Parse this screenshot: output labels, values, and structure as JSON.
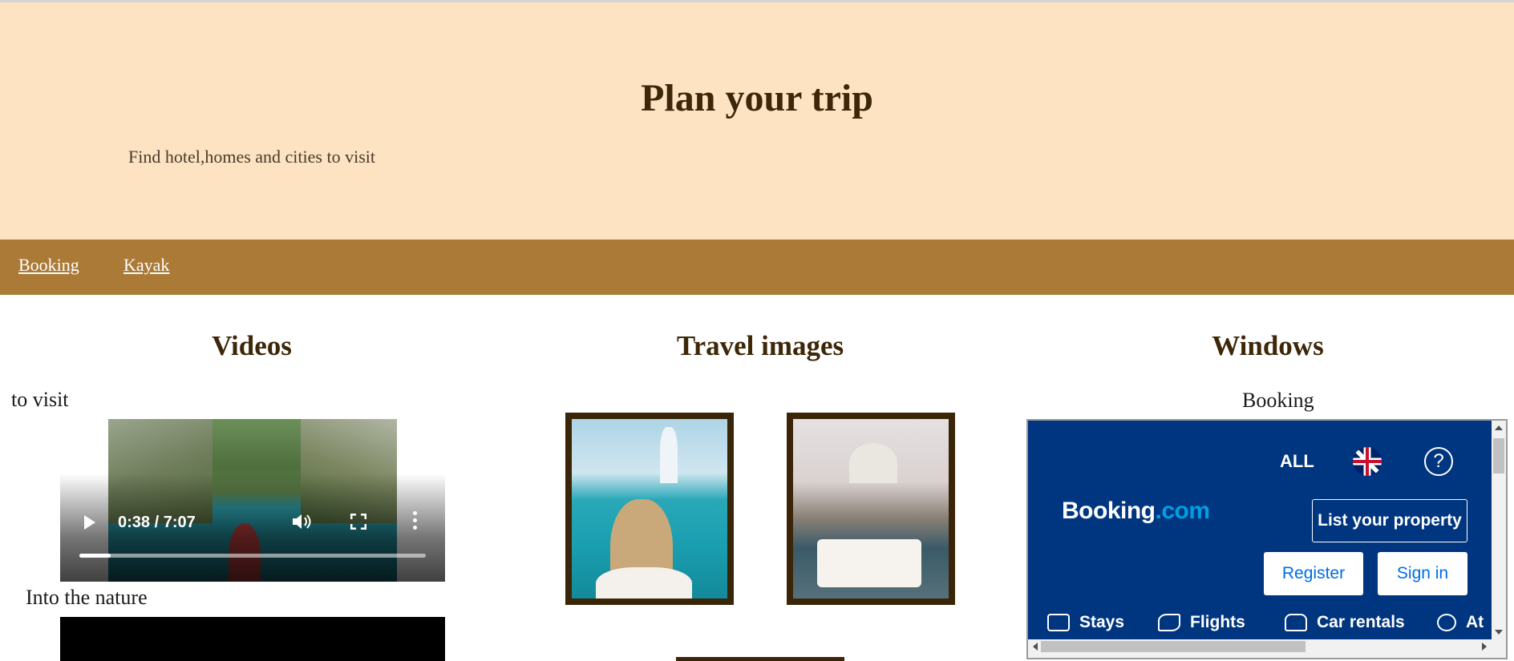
{
  "header": {
    "title": "Plan your trip",
    "subtitle": "Find hotel,homes and cities to visit"
  },
  "nav": {
    "links": [
      "Booking",
      "Kayak"
    ]
  },
  "videos": {
    "title": "Videos",
    "caption1": "to visit",
    "player": {
      "time": "0:38 / 7:07",
      "progress": 0.09
    },
    "caption2": "Into the nature"
  },
  "images": {
    "title": "Travel images"
  },
  "windows": {
    "title": "Windows",
    "label": "Booking",
    "booking": {
      "currency": "ALL",
      "help": "?",
      "logo_main": "Booking",
      "logo_suffix": ".com",
      "list_property": "List your property",
      "register": "Register",
      "sign_in": "Sign in",
      "tabs": [
        "Stays",
        "Flights",
        "Car rentals",
        "At"
      ]
    }
  },
  "colors": {
    "header_bg": "#fde3c2",
    "nav_bg": "#ab7a37",
    "heading": "#3d2708",
    "frame": "#3a2508",
    "booking_blue": "#003580"
  }
}
